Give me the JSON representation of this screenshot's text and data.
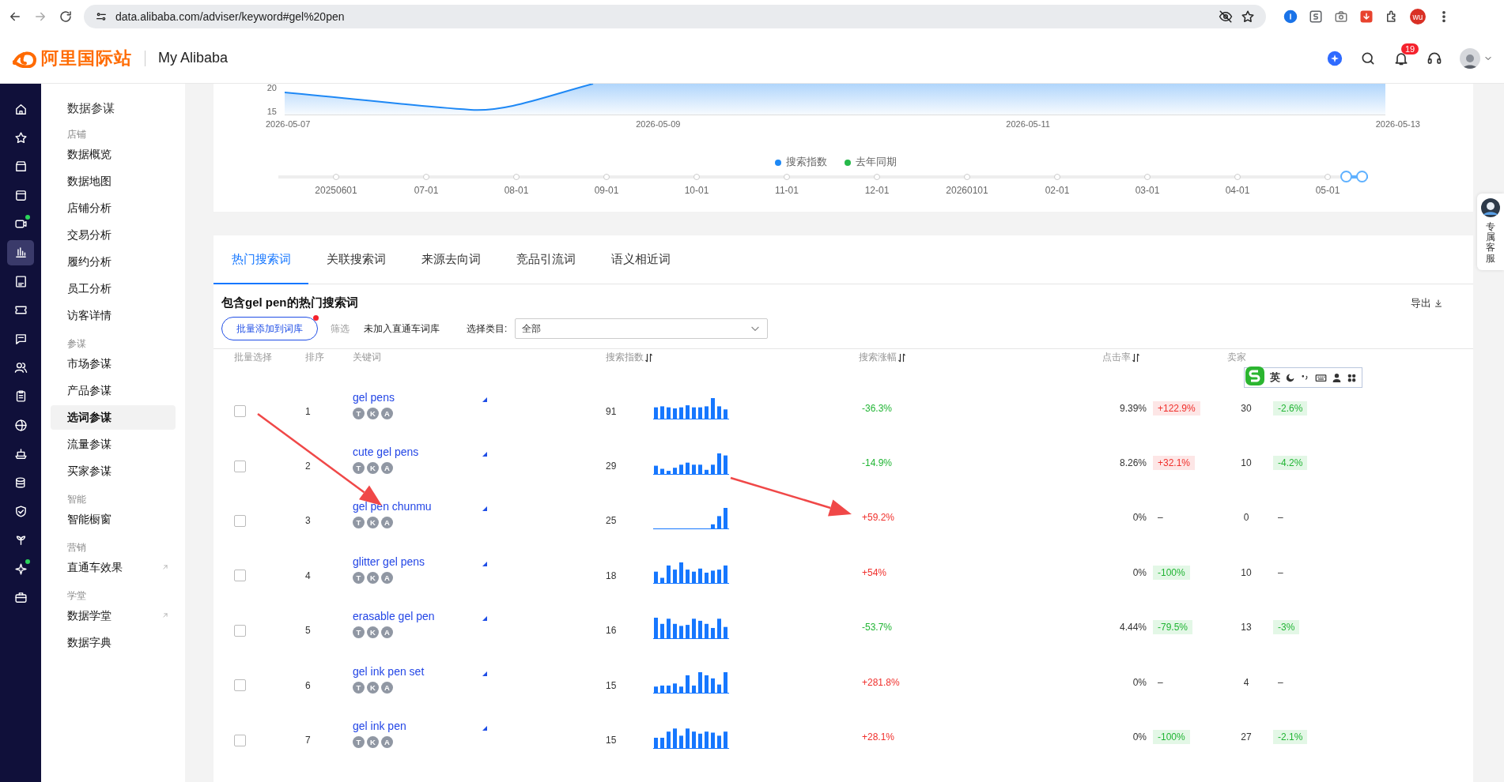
{
  "browser": {
    "url": "data.alibaba.com/adviser/keyword#gel%20pen",
    "profile": "wu"
  },
  "header": {
    "logo": "阿里国际站",
    "title": "My Alibaba",
    "notifications": "19"
  },
  "rail": {
    "items": [
      {
        "selected": false,
        "dot": false
      },
      {
        "selected": false,
        "dot": false
      },
      {
        "selected": false,
        "dot": false
      },
      {
        "selected": false,
        "dot": false
      },
      {
        "selected": false,
        "dot": true
      },
      {
        "selected": true,
        "dot": false
      },
      {
        "selected": false,
        "dot": false
      },
      {
        "selected": false,
        "dot": false
      },
      {
        "selected": false,
        "dot": false
      },
      {
        "selected": false,
        "dot": false
      },
      {
        "selected": false,
        "dot": false
      },
      {
        "selected": false,
        "dot": false
      },
      {
        "selected": false,
        "dot": false
      },
      {
        "selected": false,
        "dot": false
      },
      {
        "selected": false,
        "dot": false
      },
      {
        "selected": false,
        "dot": false
      },
      {
        "selected": false,
        "dot": true
      },
      {
        "selected": false,
        "dot": false
      }
    ]
  },
  "sidebar": {
    "title": "数据参谋",
    "groups": [
      {
        "label": "店铺",
        "items": [
          {
            "label": "数据概览",
            "selected": false,
            "external": false
          },
          {
            "label": "数据地图",
            "selected": false,
            "external": false
          },
          {
            "label": "店铺分析",
            "selected": false,
            "external": false
          },
          {
            "label": "交易分析",
            "selected": false,
            "external": false
          },
          {
            "label": "履约分析",
            "selected": false,
            "external": false
          },
          {
            "label": "员工分析",
            "selected": false,
            "external": false
          },
          {
            "label": "访客详情",
            "selected": false,
            "external": false
          }
        ]
      },
      {
        "label": "参谋",
        "items": [
          {
            "label": "市场参谋",
            "selected": false,
            "external": false
          },
          {
            "label": "产品参谋",
            "selected": false,
            "external": false
          },
          {
            "label": "选词参谋",
            "selected": true,
            "external": false
          },
          {
            "label": "流量参谋",
            "selected": false,
            "external": false
          },
          {
            "label": "买家参谋",
            "selected": false,
            "external": false
          }
        ]
      },
      {
        "label": "智能",
        "items": [
          {
            "label": "智能橱窗",
            "selected": false,
            "external": false
          }
        ]
      },
      {
        "label": "营销",
        "items": [
          {
            "label": "直通车效果",
            "selected": false,
            "external": true
          }
        ]
      },
      {
        "label": "学堂",
        "items": [
          {
            "label": "数据学堂",
            "selected": false,
            "external": true
          },
          {
            "label": "数据字典",
            "selected": false,
            "external": false
          }
        ]
      }
    ]
  },
  "chart": {
    "y_ticks": [
      "20",
      "15"
    ],
    "x_ticks": [
      "2026-05-07",
      "2026-05-09",
      "2026-05-11",
      "2026-05-13"
    ],
    "legend": [
      {
        "label": "搜索指数",
        "color": "#1e88f5"
      },
      {
        "label": "去年同期",
        "color": "#26b94a"
      }
    ],
    "timeline": {
      "labels": [
        "20250601",
        "07-01",
        "08-01",
        "09-01",
        "10-01",
        "11-01",
        "12-01",
        "20260101",
        "02-01",
        "03-01",
        "04-01",
        "05-01"
      ],
      "level": 0.985
    }
  },
  "tabs": [
    {
      "label": "热门搜索词",
      "selected": true
    },
    {
      "label": "关联搜索词",
      "selected": false
    },
    {
      "label": "来源去向词",
      "selected": false
    },
    {
      "label": "竞品引流词",
      "selected": false
    },
    {
      "label": "语义相近词",
      "selected": false
    }
  ],
  "panel": {
    "title": "包含gel pen的热门搜索词",
    "export": "导出",
    "batch_button": "批量添加到词库",
    "filter_label": "筛选",
    "filter_option": "未加入直通车词库",
    "category_label": "选择类目:",
    "category_value": "全部"
  },
  "columns": [
    {
      "label": "批量选择",
      "sortable": false
    },
    {
      "label": "排序",
      "sortable": false
    },
    {
      "label": "关键词",
      "sortable": false
    },
    {
      "label": "搜索指数",
      "sortable": true
    },
    {
      "label": "搜索涨幅",
      "sortable": true
    },
    {
      "label": "点击率",
      "sortable": true
    },
    {
      "label": "卖家",
      "sortable": false
    }
  ],
  "rows": [
    {
      "checked": false,
      "rank": "1",
      "keyword": "gel pens",
      "tags": [
        "T",
        "K",
        "A"
      ],
      "search_index": "91",
      "growth": {
        "text": "-36.3%",
        "kind": "down"
      },
      "ctr": "9.39%",
      "ctr_change": {
        "text": "+122.9%",
        "kind": "up"
      },
      "sellers": "30",
      "sellers_change": {
        "text": "-2.6%",
        "kind": "down"
      }
    },
    {
      "checked": false,
      "rank": "2",
      "keyword": "cute gel pens",
      "tags": [
        "T",
        "K",
        "A"
      ],
      "search_index": "29",
      "growth": {
        "text": "-14.9%",
        "kind": "down"
      },
      "ctr": "8.26%",
      "ctr_change": {
        "text": "+32.1%",
        "kind": "up"
      },
      "sellers": "10",
      "sellers_change": {
        "text": "-4.2%",
        "kind": "down"
      }
    },
    {
      "checked": false,
      "rank": "3",
      "keyword": "gel pen chunmu",
      "tags": [
        "T",
        "K",
        "A"
      ],
      "search_index": "25",
      "growth": {
        "text": "+59.2%",
        "kind": "up"
      },
      "ctr": "0%",
      "ctr_change": {
        "text": "–",
        "kind": "none"
      },
      "sellers": "0",
      "sellers_change": {
        "text": "–",
        "kind": "none"
      }
    },
    {
      "checked": false,
      "rank": "4",
      "keyword": "glitter gel pens",
      "tags": [
        "T",
        "K",
        "A"
      ],
      "search_index": "18",
      "growth": {
        "text": "+54%",
        "kind": "up"
      },
      "ctr": "0%",
      "ctr_change": {
        "text": "-100%",
        "kind": "down"
      },
      "sellers": "10",
      "sellers_change": {
        "text": "–",
        "kind": "none"
      }
    },
    {
      "checked": false,
      "rank": "5",
      "keyword": "erasable gel pen",
      "tags": [
        "T",
        "K",
        "A"
      ],
      "search_index": "16",
      "growth": {
        "text": "-53.7%",
        "kind": "down"
      },
      "ctr": "4.44%",
      "ctr_change": {
        "text": "-79.5%",
        "kind": "down"
      },
      "sellers": "13",
      "sellers_change": {
        "text": "-3%",
        "kind": "down"
      }
    },
    {
      "checked": false,
      "rank": "6",
      "keyword": "gel ink pen set",
      "tags": [
        "T",
        "K",
        "A"
      ],
      "search_index": "15",
      "growth": {
        "text": "+281.8%",
        "kind": "up"
      },
      "ctr": "0%",
      "ctr_change": {
        "text": "–",
        "kind": "none"
      },
      "sellers": "4",
      "sellers_change": {
        "text": "–",
        "kind": "none"
      }
    },
    {
      "checked": false,
      "rank": "7",
      "keyword": "gel ink pen",
      "tags": [
        "T",
        "K",
        "A"
      ],
      "search_index": "15",
      "growth": {
        "text": "+28.1%",
        "kind": "up"
      },
      "ctr": "0%",
      "ctr_change": {
        "text": "-100%",
        "kind": "down"
      },
      "sellers": "27",
      "sellers_change": {
        "text": "-2.1%",
        "kind": "down"
      }
    }
  ],
  "ime": {
    "mode": "英"
  },
  "service": {
    "label": "专属客服"
  }
}
